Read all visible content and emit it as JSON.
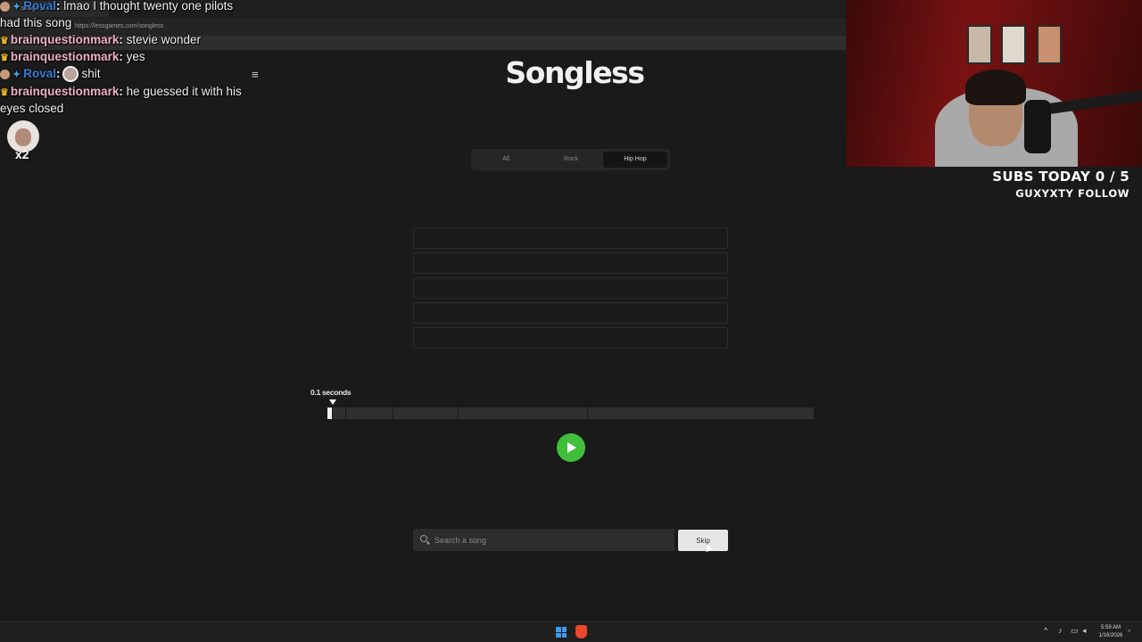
{
  "browser": {
    "tab_title": "songless",
    "url": "https://lessgames.com/songless"
  },
  "app": {
    "title": "Songless",
    "genre_tabs": [
      {
        "label": "All",
        "active": false
      },
      {
        "label": "Rock",
        "active": false
      },
      {
        "label": "Hip Hop",
        "active": true
      }
    ],
    "guess_slots": [
      "",
      "",
      "",
      "",
      ""
    ],
    "progress": {
      "label": "0.1 seconds",
      "fraction_played": 0.01
    },
    "search": {
      "placeholder": "Search a song",
      "value": ""
    },
    "skip_label": "Skip",
    "accent_color": "#3fbf3a"
  },
  "chat": [
    {
      "user": "Roval",
      "sep": ":",
      "message": "lmao I thought twenty one pilots",
      "badge": "sword-icon",
      "name_color": "#3a7ed6"
    },
    {
      "user": "",
      "sep": "",
      "message": "had this song",
      "badge": "",
      "name_color": ""
    },
    {
      "user": "brainquestionmark",
      "sep": ":",
      "message": "stevie wonder",
      "badge": "crown-icon",
      "name_color": "#f0b0c8"
    },
    {
      "user": "brainquestionmark",
      "sep": ":",
      "message": "yes",
      "badge": "crown-icon",
      "name_color": "#f0b0c8"
    },
    {
      "user": "Roval",
      "sep": ":",
      "message": "shit",
      "badge": "sword-icon",
      "name_color": "#3a7ed6"
    },
    {
      "user": "brainquestionmark",
      "sep": ":",
      "message": "he guessed it with his",
      "badge": "crown-icon",
      "name_color": "#f0b0c8"
    },
    {
      "user": "",
      "sep": "",
      "message": "eyes closed",
      "badge": "",
      "name_color": ""
    }
  ],
  "emote_count": "x2",
  "overlay": {
    "subs_today": "SUBS TODAY 0 / 5",
    "follow": "GUXYXTY FOLLOW"
  },
  "taskbar": {
    "time": "5:59 AM",
    "date": "1/16/2026"
  }
}
